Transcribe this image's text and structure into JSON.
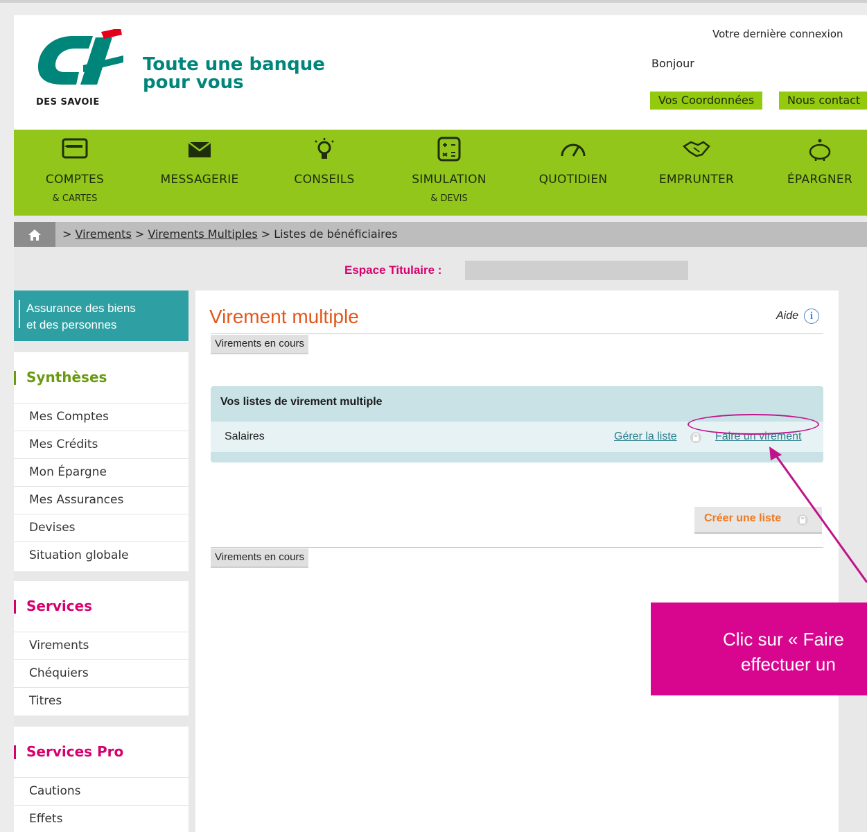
{
  "header": {
    "brand": "DES SAVOIE",
    "tagline_line1": "Toute une banque",
    "tagline_line2": "pour vous",
    "last_connection": "Votre dernière connexion",
    "greeting": "Bonjour",
    "btn_coordonnees": "Vos Coordonnées",
    "btn_contact": "Nous contact"
  },
  "nav": {
    "items": [
      {
        "label": "COMPTES",
        "sub": "& CARTES",
        "icon": "card-icon"
      },
      {
        "label": "MESSAGERIE",
        "sub": "",
        "icon": "envelope-icon"
      },
      {
        "label": "CONSEILS",
        "sub": "",
        "icon": "lightbulb-icon"
      },
      {
        "label": "SIMULATION",
        "sub": "& DEVIS",
        "icon": "calculator-icon"
      },
      {
        "label": "QUOTIDIEN",
        "sub": "",
        "icon": "gauge-icon"
      },
      {
        "label": "EMPRUNTER",
        "sub": "",
        "icon": "handshake-icon"
      },
      {
        "label": "ÉPARGNER",
        "sub": "",
        "icon": "piggy-bank-icon"
      }
    ]
  },
  "breadcrumb": {
    "sep": ">",
    "link1": "Virements",
    "link2": "Virements Multiples",
    "current": "Listes de bénéficiaires"
  },
  "espace_titulaire": "Espace Titulaire :",
  "sidebar": {
    "promo": "Assurance des biens et des personnes",
    "promo_line1": "Assurance des biens",
    "promo_line2": "et des personnes",
    "syntheses": {
      "title": "Synthèses",
      "items": [
        "Mes Comptes",
        "Mes Crédits",
        "Mon Épargne",
        "Mes Assurances",
        "Devises",
        "Situation globale"
      ]
    },
    "services": {
      "title": "Services",
      "items": [
        "Virements",
        "Chéquiers",
        "Titres"
      ]
    },
    "services_pro": {
      "title": "Services Pro",
      "items": [
        "Cautions",
        "Effets"
      ]
    }
  },
  "main": {
    "title": "Virement multiple",
    "aide": "Aide",
    "tab_top": "Virements en cours",
    "list_header": "Vos listes de virement multiple",
    "row_name": "Salaires",
    "link_manage": "Gérer la liste",
    "link_transfer": "Faire un virement",
    "create_btn": "Créer une liste",
    "tab_bottom": "Virements en cours"
  },
  "annotation": {
    "line1": "Clic sur « Faire",
    "line2": "effectuer un"
  },
  "colors": {
    "green": "#92c61a",
    "teal": "#2e9fa3",
    "magenta": "#d6006d",
    "orange": "#e4561b"
  }
}
